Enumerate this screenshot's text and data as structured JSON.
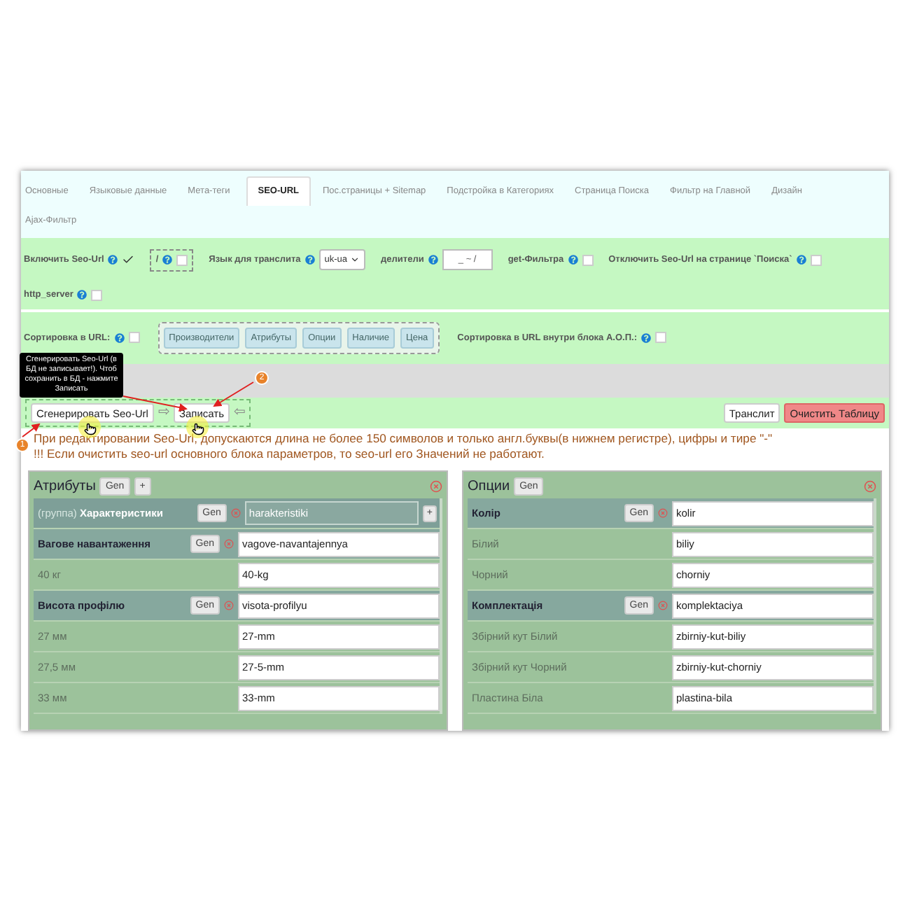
{
  "tabs": [
    {
      "label": "Основные",
      "selected": false
    },
    {
      "label": "Языковые данные",
      "selected": false
    },
    {
      "label": "Мета-теги",
      "selected": false
    },
    {
      "label": "SEO-URL",
      "selected": true
    },
    {
      "label": "Пос.страницы + Sitemap",
      "selected": false
    },
    {
      "label": "Подстройка в Категориях",
      "selected": false
    },
    {
      "label": "Страница Поиска",
      "selected": false
    },
    {
      "label": "Фильтр на Главной",
      "selected": false
    },
    {
      "label": "Дизайн",
      "selected": false
    },
    {
      "label": "Ajax-Фильтр",
      "selected": false
    }
  ],
  "settings_rows": [
    {
      "items": [
        {
          "kind": "checkbox",
          "label": "Включить Seo-Url",
          "checked": true
        },
        {
          "kind": "boxed_checkbox",
          "label": "/",
          "checked": false
        },
        {
          "kind": "select",
          "label": "Язык для транслита",
          "value": "uk-ua"
        },
        {
          "kind": "text",
          "label": "делители",
          "value": "_ ~ /"
        },
        {
          "kind": "checkbox",
          "label": "get-Фильтра",
          "checked": false
        },
        {
          "kind": "checkbox",
          "label": "Отключить Seo-Url на странице `Поиска`",
          "checked": false
        }
      ]
    },
    {
      "items": [
        {
          "kind": "checkbox",
          "label": "http_server",
          "checked": false
        }
      ]
    }
  ],
  "sorting_row": {
    "items": [
      {
        "kind": "checkbox",
        "label": "Сортировка в URL:",
        "checked": false
      },
      {
        "kind": "chips",
        "chips": [
          "Производители",
          "Атрибуты",
          "Опции",
          "Наличие",
          "Цена"
        ]
      },
      {
        "kind": "checkbox",
        "label": "Сортировка в URL внутри блока А.О.П.:",
        "checked": false
      }
    ]
  },
  "tooltip": {
    "text": "Сгенерировать Seo-Url (в БД не записывает!). Чтоб сохранить в БД - нажмите Записать"
  },
  "toolbar": {
    "left": [
      {
        "kind": "button",
        "label": "Сгенерировать Seo-Url"
      },
      {
        "kind": "arrow",
        "label": "⇨"
      },
      {
        "kind": "button",
        "label": "Записать"
      },
      {
        "kind": "arrow",
        "label": "⇦"
      }
    ],
    "right": [
      {
        "kind": "button",
        "label": "Транслит"
      },
      {
        "kind": "danger_button",
        "label": "Очистить Таблицу"
      }
    ]
  },
  "notes": [
    "При редактировании Seo-Url, допускаются длина не более 150 символов и только англ.буквы(в нижнем регистре), цифры и тире \"-\"",
    "!!! Если очистить seo-url основного блока параметров, то seo-url его Значений не работают."
  ],
  "markers": [
    "1",
    "2"
  ],
  "panels": [
    {
      "title": "Атрибуты",
      "buttons": [
        "Gen",
        "+"
      ],
      "rows": [
        {
          "kind": "group",
          "prefix": "(группа)",
          "label": "Характеристики",
          "gen": "Gen",
          "value": "harakteristiki",
          "add": "+"
        },
        {
          "kind": "header",
          "label": "Вагове навантаження",
          "gen": "Gen",
          "value": "vagove-navantajennya"
        },
        {
          "kind": "value",
          "label": "40 кг",
          "value": "40-kg"
        },
        {
          "kind": "header",
          "label": "Висота профілю",
          "gen": "Gen",
          "value": "visota-profilyu"
        },
        {
          "kind": "value",
          "label": "27 мм",
          "value": "27-mm"
        },
        {
          "kind": "value",
          "label": "27,5 мм",
          "value": "27-5-mm"
        },
        {
          "kind": "value",
          "label": "33 мм",
          "value": "33-mm"
        }
      ]
    },
    {
      "title": "Опции",
      "buttons": [
        "Gen"
      ],
      "rows": [
        {
          "kind": "header",
          "label": "Колір",
          "gen": "Gen",
          "value": "kolir"
        },
        {
          "kind": "value",
          "label": "Білий",
          "value": "biliy"
        },
        {
          "kind": "value",
          "label": "Чорний",
          "value": "chorniy"
        },
        {
          "kind": "header",
          "label": "Комплектація",
          "gen": "Gen",
          "value": "komplektaciya"
        },
        {
          "kind": "value",
          "label": "Збірний кут Білий",
          "value": "zbirniy-kut-biliy"
        },
        {
          "kind": "value",
          "label": "Збірний кут Чорний",
          "value": "zbirniy-kut-chorniy"
        },
        {
          "kind": "value",
          "label": "Пластина Біла",
          "value": "plastina-bila"
        }
      ]
    }
  ]
}
